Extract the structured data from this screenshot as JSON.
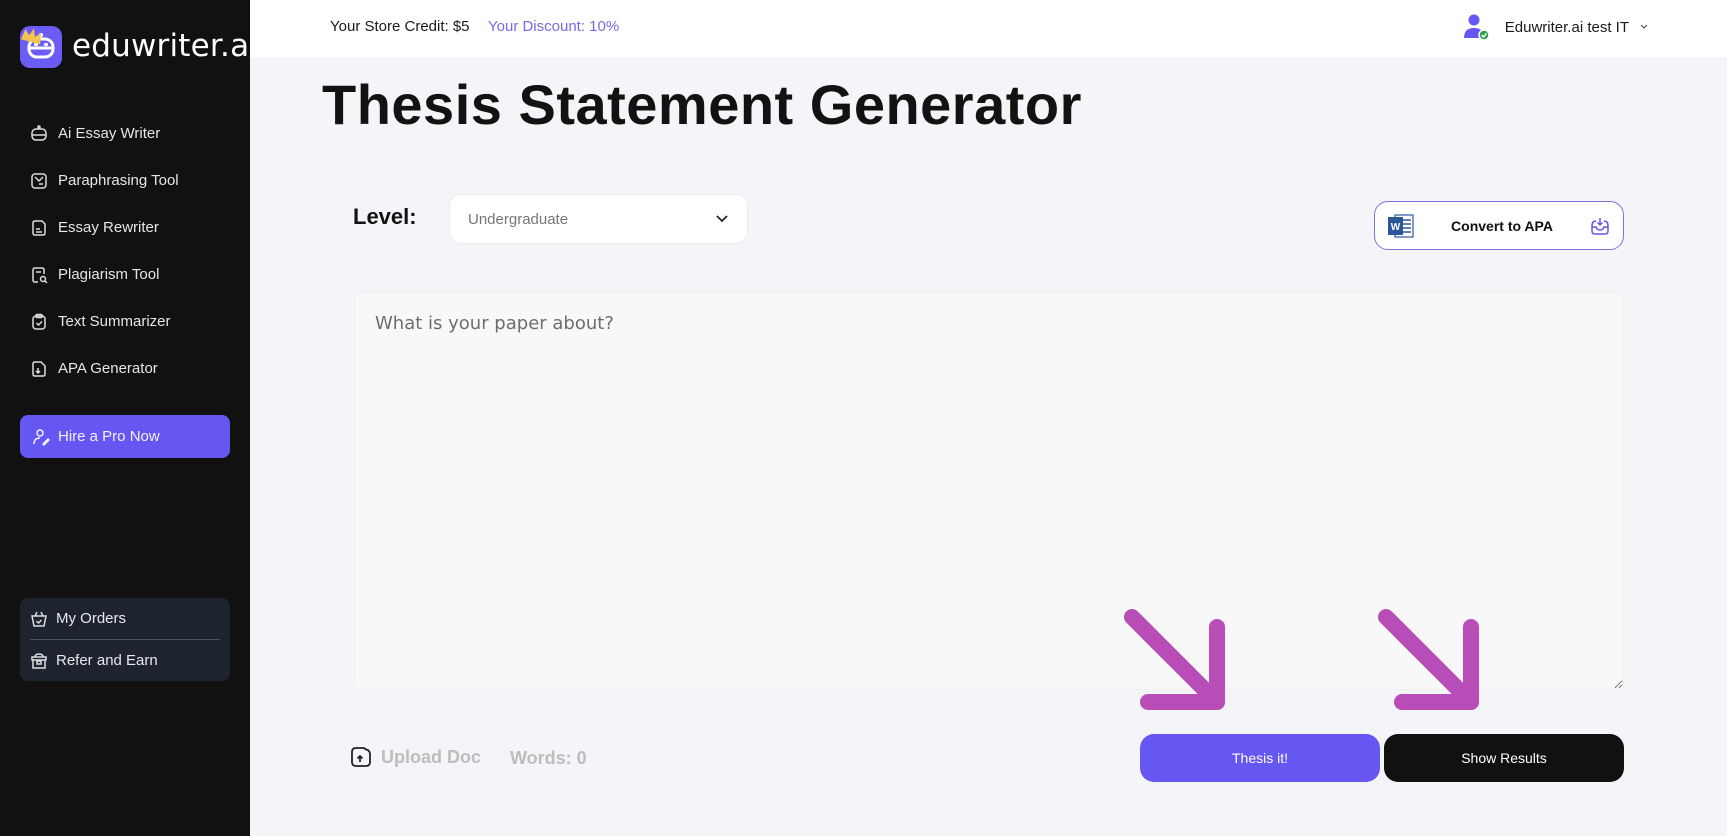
{
  "brand": {
    "name": "eduwriter.ai",
    "accent": "#6657f2",
    "crown_color": "#f3c24f"
  },
  "sidebar": {
    "items": [
      {
        "label": "Ai Essay Writer",
        "icon": "robot-icon"
      },
      {
        "label": "Paraphrasing Tool",
        "icon": "paraphrase-icon"
      },
      {
        "label": "Essay Rewriter",
        "icon": "document-edit-icon"
      },
      {
        "label": "Plagiarism Tool",
        "icon": "document-search-icon"
      },
      {
        "label": "Text Summarizer",
        "icon": "clipboard-check-icon"
      },
      {
        "label": "APA Generator",
        "icon": "document-download-icon"
      }
    ],
    "hire_button": {
      "label": "Hire a Pro Now",
      "icon": "user-edit-icon"
    },
    "bottom_items": [
      {
        "label": "My Orders",
        "icon": "basket-check-icon"
      },
      {
        "label": "Refer and Earn",
        "icon": "gift-box-icon"
      }
    ]
  },
  "header": {
    "store_credit": "Your Store Credit: $5",
    "discount": "Your Discount: 10%",
    "user_name": "Eduwriter.ai test IT",
    "user_icon": "user-verified-icon",
    "caret_icon": "chevron-down-icon"
  },
  "main": {
    "title": "Thesis Statement Generator",
    "level_label": "Level:",
    "level_value": "Undergraduate",
    "convert_button": {
      "label": "Convert to APA",
      "left_icon": "word-doc-icon",
      "right_icon": "inbox-download-icon"
    },
    "textarea": {
      "placeholder": "What is your paper about?",
      "value": ""
    },
    "upload_label": "Upload Doc",
    "words_label": "Words: 0",
    "thesis_button": "Thesis it!",
    "results_button": "Show Results",
    "annotation_arrow_color": "#b84db8"
  }
}
